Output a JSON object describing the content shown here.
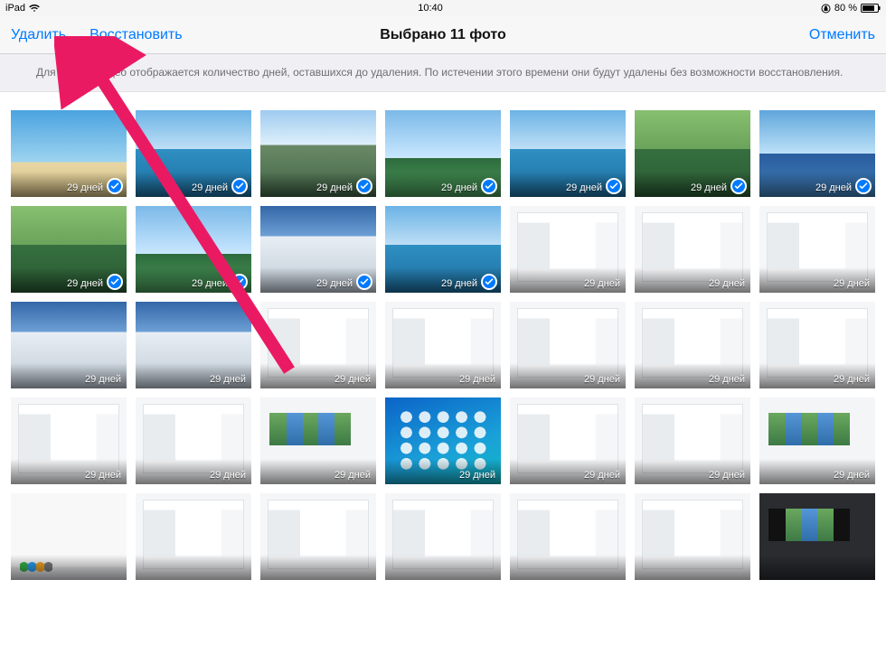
{
  "status": {
    "device": "iPad",
    "time": "10:40",
    "battery_text": "80 %"
  },
  "nav": {
    "delete": "Удалить",
    "restore": "Восстановить",
    "title": "Выбрано 11 фото",
    "cancel": "Отменить"
  },
  "info": "Для фото и видео отображается количество дней, оставшихся до удаления. По истечении этого времени они будут удалены без возможности восстановления.",
  "photos": [
    {
      "label": "29 дней",
      "style": "beach",
      "selected": true
    },
    {
      "label": "29 дней",
      "style": "lake",
      "selected": true
    },
    {
      "label": "29 дней",
      "style": "mtn",
      "selected": true
    },
    {
      "label": "29 дней",
      "style": "sky",
      "selected": true
    },
    {
      "label": "29 дней",
      "style": "lake",
      "selected": true
    },
    {
      "label": "29 дней",
      "style": "green",
      "selected": true
    },
    {
      "label": "29 дней",
      "style": "sky2",
      "selected": true
    },
    {
      "label": "29 дней",
      "style": "green",
      "selected": true
    },
    {
      "label": "29 дней",
      "style": "sky",
      "selected": true
    },
    {
      "label": "29 дней",
      "style": "snow",
      "selected": true
    },
    {
      "label": "29 дней",
      "style": "lake",
      "selected": true
    },
    {
      "label": "29 дней",
      "style": "shot",
      "selected": false
    },
    {
      "label": "29 дней",
      "style": "shot",
      "selected": false
    },
    {
      "label": "29 дней",
      "style": "shot",
      "selected": false
    },
    {
      "label": "29 дней",
      "style": "snow",
      "selected": false
    },
    {
      "label": "29 дней",
      "style": "snow",
      "selected": false
    },
    {
      "label": "29 дней",
      "style": "shot",
      "selected": false
    },
    {
      "label": "29 дней",
      "style": "shot",
      "selected": false
    },
    {
      "label": "29 дней",
      "style": "shot",
      "selected": false
    },
    {
      "label": "29 дней",
      "style": "shot",
      "selected": false
    },
    {
      "label": "29 дней",
      "style": "shot",
      "selected": false
    },
    {
      "label": "29 дней",
      "style": "shot",
      "selected": false
    },
    {
      "label": "29 дней",
      "style": "shot",
      "selected": false
    },
    {
      "label": "29 дней",
      "style": "gallery",
      "selected": false
    },
    {
      "label": "29 дней",
      "style": "home",
      "selected": false
    },
    {
      "label": "29 дней",
      "style": "shot",
      "selected": false
    },
    {
      "label": "29 дней",
      "style": "shot",
      "selected": false
    },
    {
      "label": "29 дней",
      "style": "gallery",
      "selected": false
    },
    {
      "label": "",
      "style": "dock",
      "selected": false
    },
    {
      "label": "",
      "style": "shot",
      "selected": false
    },
    {
      "label": "",
      "style": "shot",
      "selected": false
    },
    {
      "label": "",
      "style": "shot",
      "selected": false
    },
    {
      "label": "",
      "style": "shot",
      "selected": false
    },
    {
      "label": "",
      "style": "shot",
      "selected": false
    },
    {
      "label": "",
      "style": "dark",
      "selected": false
    }
  ]
}
